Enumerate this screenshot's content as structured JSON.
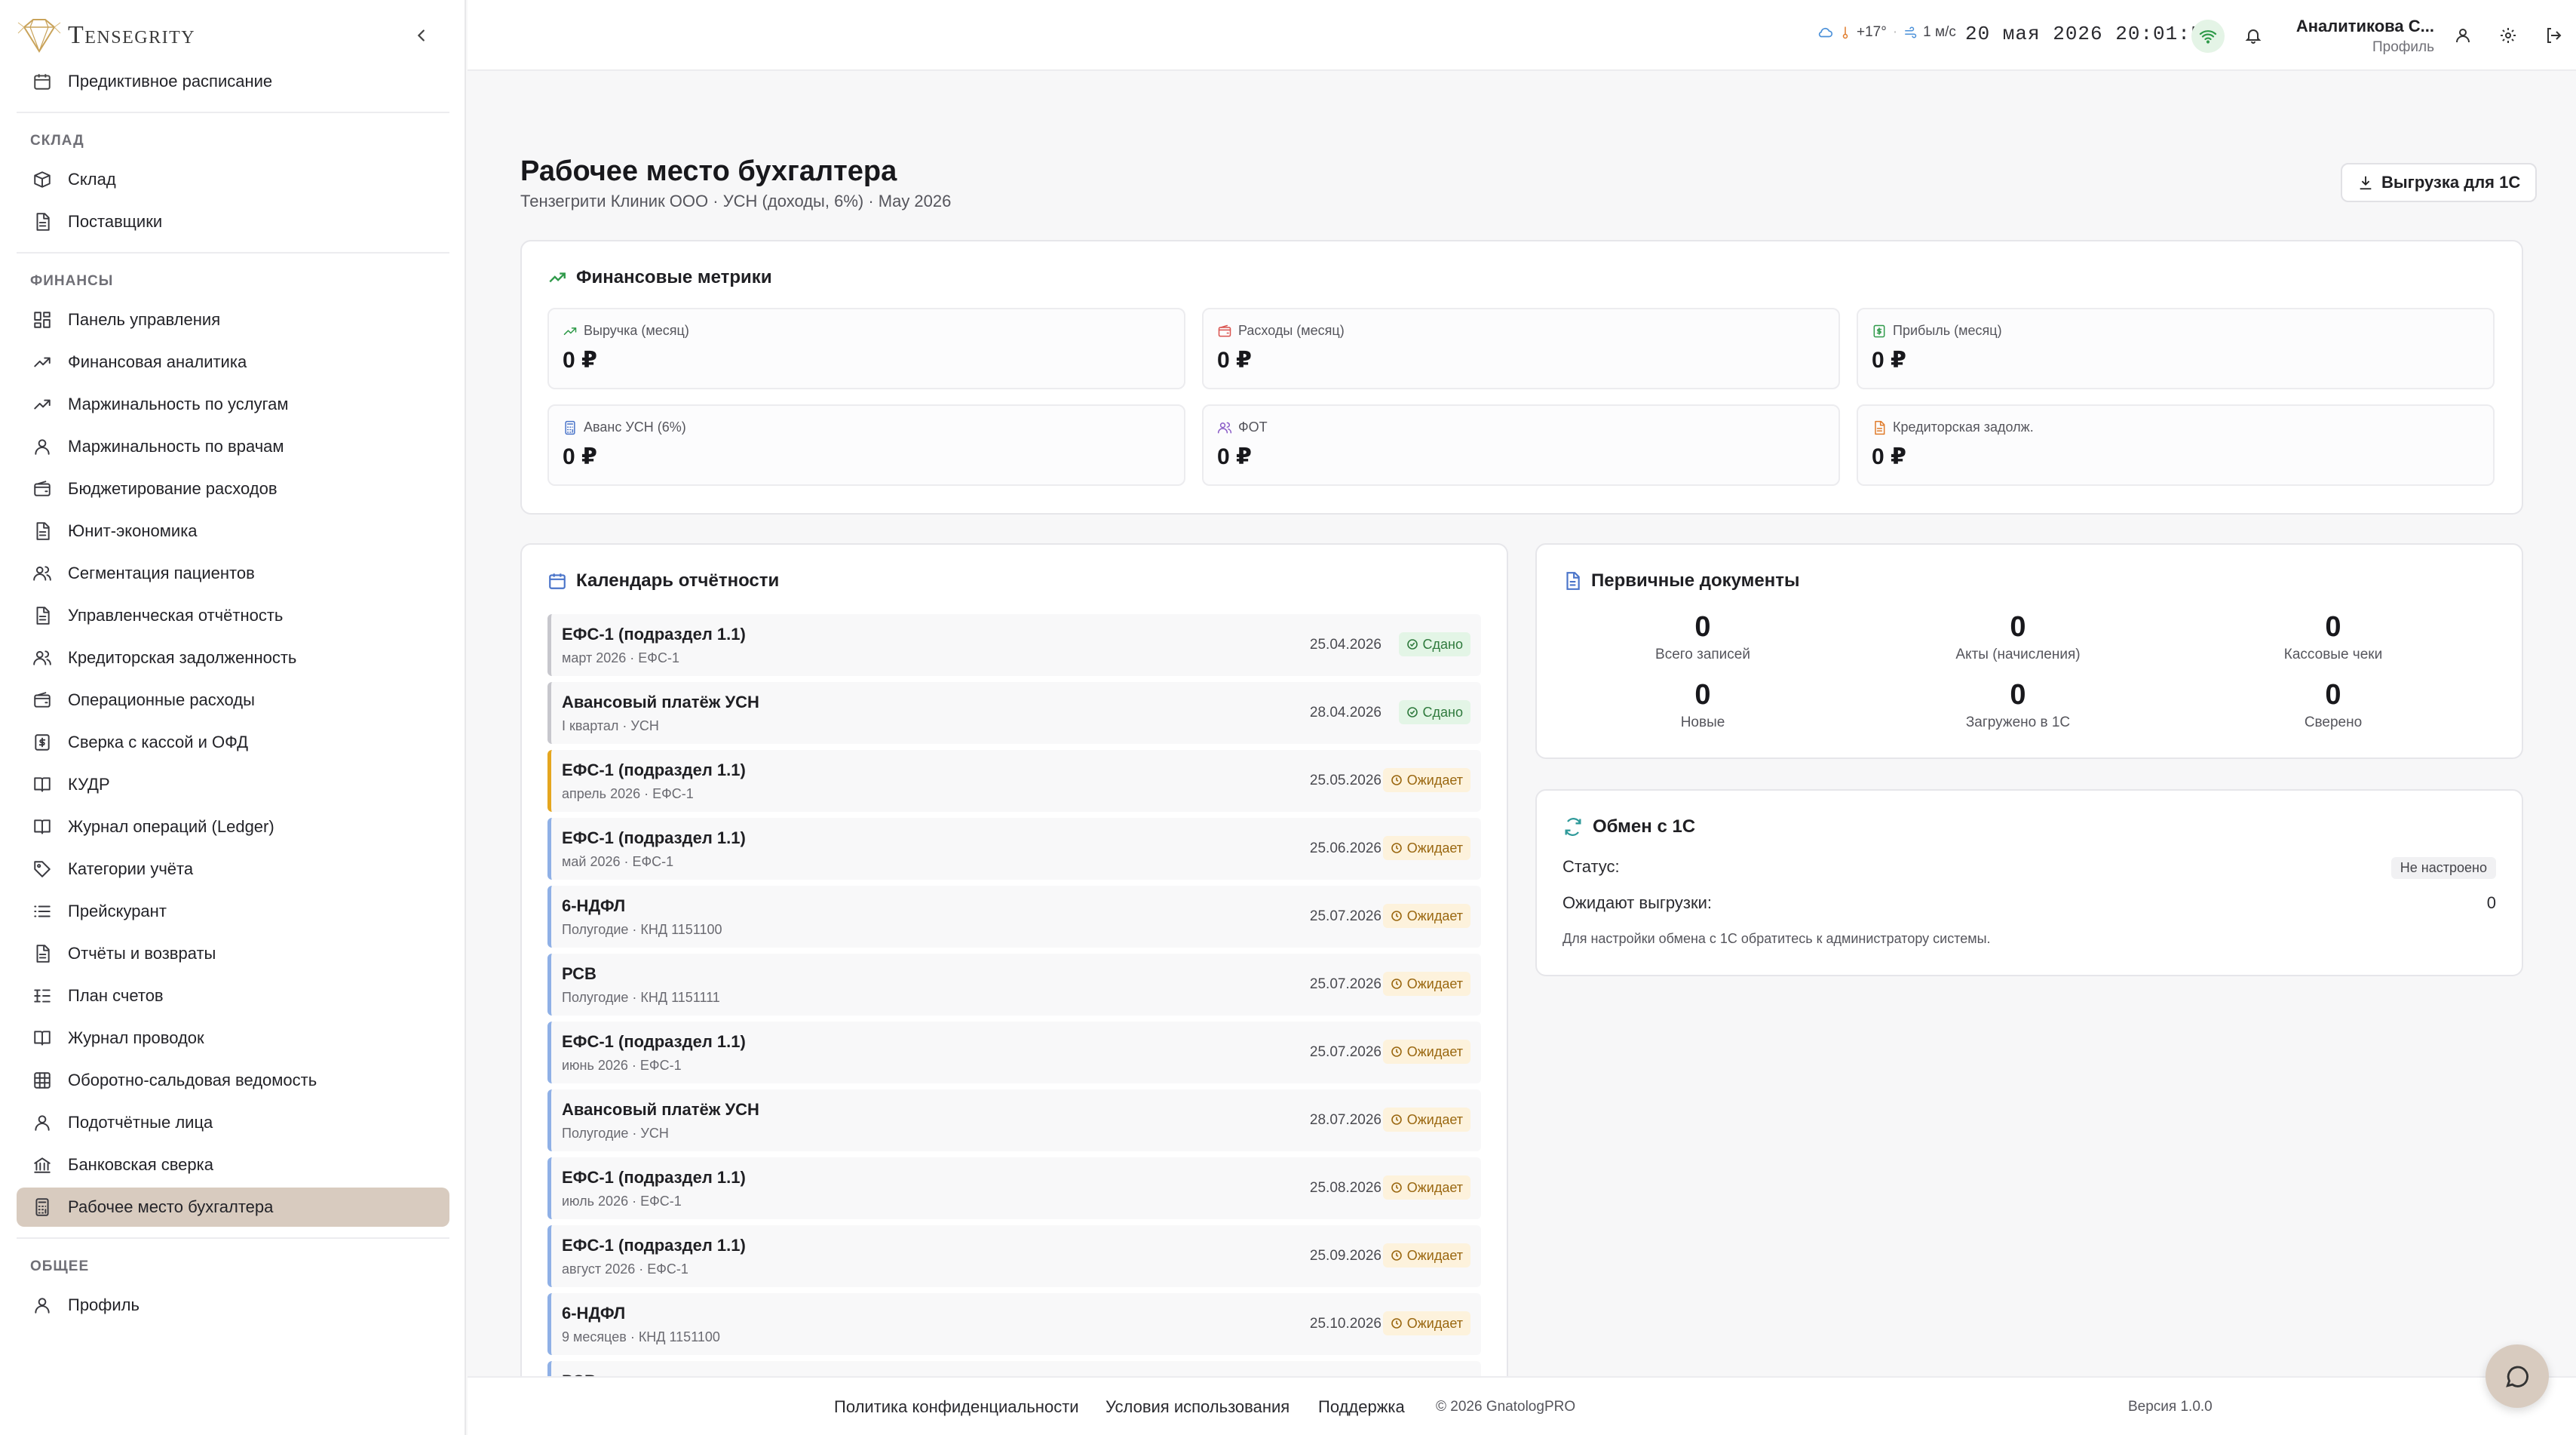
{
  "app": {
    "brand": "Tensegrity"
  },
  "sidebar": {
    "top_item": "Предиктивное расписание",
    "sections": [
      {
        "title": "СКЛАД",
        "items": [
          {
            "label": "Склад",
            "icon": "box-icon"
          },
          {
            "label": "Поставщики",
            "icon": "file-icon"
          }
        ]
      },
      {
        "title": "ФИНАНСЫ",
        "items": [
          {
            "label": "Панель управления",
            "icon": "dashboard-icon"
          },
          {
            "label": "Финансовая аналитика",
            "icon": "trend-icon"
          },
          {
            "label": "Маржинальность по услугам",
            "icon": "trend-icon"
          },
          {
            "label": "Маржинальность по врачам",
            "icon": "user-icon"
          },
          {
            "label": "Бюджетирование расходов",
            "icon": "wallet-icon"
          },
          {
            "label": "Юнит-экономика",
            "icon": "file-icon"
          },
          {
            "label": "Сегментация пациентов",
            "icon": "users-icon"
          },
          {
            "label": "Управленческая отчётность",
            "icon": "file-icon"
          },
          {
            "label": "Кредиторская задолженность",
            "icon": "users-icon"
          },
          {
            "label": "Операционные расходы",
            "icon": "wallet-icon"
          },
          {
            "label": "Сверка с кассой и ОФД",
            "icon": "dollar-icon"
          },
          {
            "label": "КУДР",
            "icon": "book-icon"
          },
          {
            "label": "Журнал операций (Ledger)",
            "icon": "book-icon"
          },
          {
            "label": "Категории учёта",
            "icon": "tag-icon"
          },
          {
            "label": "Прейскурант",
            "icon": "list-icon"
          },
          {
            "label": "Отчёты и возвраты",
            "icon": "file-icon"
          },
          {
            "label": "План счетов",
            "icon": "list-tree-icon"
          },
          {
            "label": "Журнал проводок",
            "icon": "book-icon"
          },
          {
            "label": "Оборотно-сальдовая ведомость",
            "icon": "table-icon"
          },
          {
            "label": "Подотчётные лица",
            "icon": "user-icon"
          },
          {
            "label": "Банковская сверка",
            "icon": "bank-icon"
          },
          {
            "label": "Рабочее место бухгалтера",
            "icon": "calculator-icon",
            "active": true
          }
        ]
      },
      {
        "title": "ОБЩЕЕ",
        "items": [
          {
            "label": "Профиль",
            "icon": "user-icon"
          }
        ]
      }
    ]
  },
  "topbar": {
    "temperature": "+17°",
    "wind": "1 м/с",
    "date": "20 мая 2026",
    "time": "20:01:53",
    "user_name": "Аналитикова С...",
    "user_link": "Профиль"
  },
  "page": {
    "title": "Рабочее место бухгалтера",
    "subtitle": "Тензегрити Клиник ООО · УСН (доходы, 6%) · May 2026",
    "export_label": "Выгрузка для 1С"
  },
  "metrics": {
    "title": "Финансовые метрики",
    "items": [
      {
        "label": "Выручка (месяц)",
        "value": "0 ₽",
        "icon": "trend-icon",
        "color": "#2f9a4a"
      },
      {
        "label": "Расходы (месяц)",
        "value": "0 ₽",
        "icon": "wallet-icon",
        "color": "#d9534f"
      },
      {
        "label": "Прибыль (месяц)",
        "value": "0 ₽",
        "icon": "dollar-icon",
        "color": "#2f9a4a"
      },
      {
        "label": "Аванс УСН (6%)",
        "value": "0 ₽",
        "icon": "calculator-icon",
        "color": "#4a74c9"
      },
      {
        "label": "ФОТ",
        "value": "0 ₽",
        "icon": "users-icon",
        "color": "#8a5cc7"
      },
      {
        "label": "Кредиторская задолж.",
        "value": "0 ₽",
        "icon": "file-icon",
        "color": "#e07b2a"
      }
    ]
  },
  "calendar": {
    "title": "Календарь отчётности",
    "rows": [
      {
        "title": "ЕФС-1 (подраздел 1.1)",
        "sub": "март 2026 · ЕФС-1",
        "date": "25.04.2026",
        "status": "Сдано",
        "kind": "done"
      },
      {
        "title": "Авансовый платёж УСН",
        "sub": "I квартал · УСН",
        "date": "28.04.2026",
        "status": "Сдано",
        "kind": "done"
      },
      {
        "title": "ЕФС-1 (подраздел 1.1)",
        "sub": "апрель 2026 · ЕФС-1",
        "date": "25.05.2026",
        "status": "Ожидает",
        "kind": "next"
      },
      {
        "title": "ЕФС-1 (подраздел 1.1)",
        "sub": "май 2026 · ЕФС-1",
        "date": "25.06.2026",
        "status": "Ожидает",
        "kind": "wait"
      },
      {
        "title": "6-НДФЛ",
        "sub": "Полугодие · КНД 1151100",
        "date": "25.07.2026",
        "status": "Ожидает",
        "kind": "wait"
      },
      {
        "title": "РСВ",
        "sub": "Полугодие · КНД 1151111",
        "date": "25.07.2026",
        "status": "Ожидает",
        "kind": "wait"
      },
      {
        "title": "ЕФС-1 (подраздел 1.1)",
        "sub": "июнь 2026 · ЕФС-1",
        "date": "25.07.2026",
        "status": "Ожидает",
        "kind": "wait"
      },
      {
        "title": "Авансовый платёж УСН",
        "sub": "Полугодие · УСН",
        "date": "28.07.2026",
        "status": "Ожидает",
        "kind": "wait"
      },
      {
        "title": "ЕФС-1 (подраздел 1.1)",
        "sub": "июль 2026 · ЕФС-1",
        "date": "25.08.2026",
        "status": "Ожидает",
        "kind": "wait"
      },
      {
        "title": "ЕФС-1 (подраздел 1.1)",
        "sub": "август 2026 · ЕФС-1",
        "date": "25.09.2026",
        "status": "Ожидает",
        "kind": "wait"
      },
      {
        "title": "6-НДФЛ",
        "sub": "9 месяцев · КНД 1151100",
        "date": "25.10.2026",
        "status": "Ожидает",
        "kind": "wait"
      },
      {
        "title": "РСВ",
        "sub": "",
        "date": "",
        "status": "",
        "kind": "wait"
      }
    ]
  },
  "documents": {
    "title": "Первичные документы",
    "stats": [
      {
        "value": "0",
        "label": "Всего записей"
      },
      {
        "value": "0",
        "label": "Акты (начисления)"
      },
      {
        "value": "0",
        "label": "Кассовые чеки"
      },
      {
        "value": "0",
        "label": "Новые"
      },
      {
        "value": "0",
        "label": "Загружено в 1С"
      },
      {
        "value": "0",
        "label": "Сверено"
      }
    ]
  },
  "exchange": {
    "title": "Обмен с 1С",
    "status_label": "Статус:",
    "status_value": "Не настроено",
    "pending_label": "Ожидают выгрузки:",
    "pending_value": "0",
    "note": "Для настройки обмена с 1С обратитесь к администратору системы."
  },
  "footer": {
    "privacy": "Политика конфиденциальности",
    "terms": "Условия использования",
    "support": "Поддержка",
    "copyright": "© 2026 GnatologPRO",
    "version": "Версия 1.0.0"
  }
}
